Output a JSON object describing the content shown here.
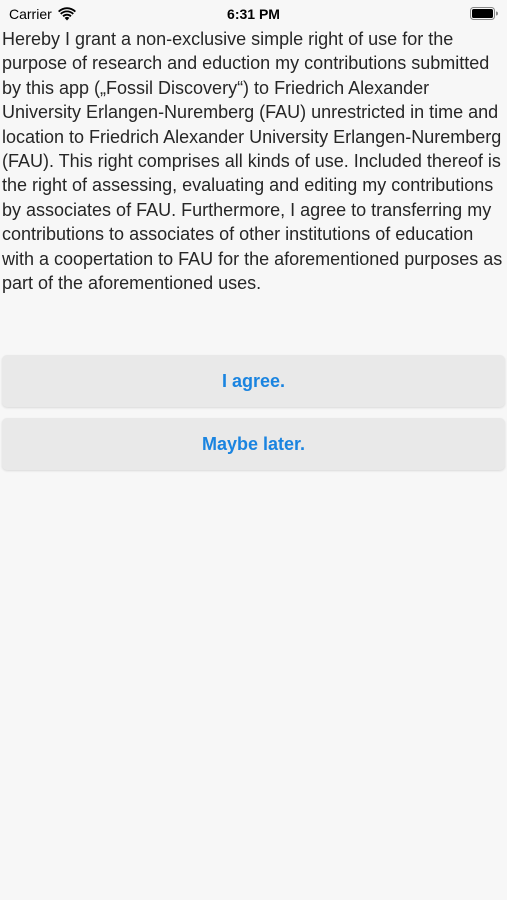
{
  "status_bar": {
    "carrier": "Carrier",
    "time": "6:31 PM",
    "icons": [
      "wifi-icon",
      "battery-icon"
    ]
  },
  "consent": {
    "text": "Hereby I grant a non-exclusive simple right of use for the purpose of research and eduction my contributions submitted by this app („Fossil Discovery“) to Friedrich Alexander University Erlangen-Nuremberg (FAU) unrestricted in time and location to Friedrich Alexander University Erlangen-Nuremberg (FAU). This right comprises all kinds of use. Included thereof is the right of assessing, evaluating and editing my contributions by associates of FAU. Furthermore, I agree to transferring my contributions to associates of other institutions of education with a coopertation to FAU for the aforementioned purposes as part of the aforementioned uses."
  },
  "buttons": {
    "agree_label": "I agree.",
    "later_label": "Maybe later."
  },
  "colors": {
    "accent": "#1a84e0",
    "background": "#f7f7f7",
    "button_background": "#e9e9e9"
  }
}
